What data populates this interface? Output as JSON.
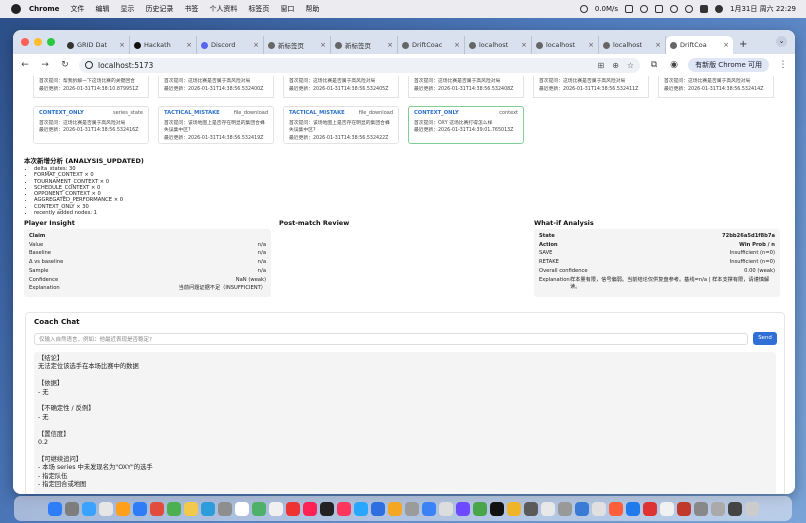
{
  "menubar": {
    "app": "Chrome",
    "items": [
      "文件",
      "编辑",
      "显示",
      "历史记录",
      "书签",
      "个人资料",
      "标签页",
      "窗口",
      "帮助"
    ],
    "network": "0.0M/s",
    "datetime": "1月31日 周六 22:29"
  },
  "tabs": [
    {
      "label": "GRID Dat",
      "active": false,
      "fav": "#333"
    },
    {
      "label": "Hackath",
      "active": false,
      "fav": "#111"
    },
    {
      "label": "Discord",
      "active": false,
      "fav": "#5865f2"
    },
    {
      "label": "新标签页",
      "active": false,
      "fav": "#666"
    },
    {
      "label": "新标签页",
      "active": false,
      "fav": "#666"
    },
    {
      "label": "DriftCoac",
      "active": false,
      "fav": "#666"
    },
    {
      "label": "localhost",
      "active": false,
      "fav": "#666"
    },
    {
      "label": "localhost",
      "active": false,
      "fav": "#666"
    },
    {
      "label": "localhost",
      "active": false,
      "fav": "#666"
    },
    {
      "label": "DriftCoa",
      "active": true,
      "fav": "#666"
    }
  ],
  "toolbar": {
    "url": "localhost:5173",
    "upgrade_label": "有新版 Chrome 可用"
  },
  "top_cards": [
    {
      "l1": "首次提问：帮我拆解一下这场比赛的关键回合",
      "l2": "最近更新：2026-01-31T14:38:10.879951Z"
    },
    {
      "l1": "首次提问：这场比赛是否属于高风险对局",
      "l2": "最近更新：2026-01-31T14:38:56.532400Z"
    },
    {
      "l1": "首次提问：这场比赛是否属于高风险对局",
      "l2": "最近更新：2026-01-31T14:38:56.532405Z"
    },
    {
      "l1": "首次提问：这场比赛是否属于高风险对局",
      "l2": "最近更新：2026-01-31T14:38:56.532408Z"
    },
    {
      "l1": "首次提问：这场比赛是否属于高风险对局",
      "l2": "最近更新：2026-01-31T14:38:56.532411Z"
    },
    {
      "l1": "首次提问：这场比赛是否属于高风险对局",
      "l2": "最近更新：2026-01-31T14:38:56.532414Z"
    }
  ],
  "context_cards": [
    {
      "type": "CONTEXT_ONLY",
      "kind": "series_state",
      "l1": "首次提问：这场比赛是否属于高风险对局",
      "l2": "最近更新：2026-01-31T14:38:56.532416Z",
      "l3": "",
      "highlight": false
    },
    {
      "type": "TACTICAL_MISTAKE",
      "kind": "file_download",
      "l1": "首次提问：该场地图上是否存在明显的集团合蜂",
      "l2": "失误集中区?",
      "l3": "最近更新：2026-01-31T14:38:56.532419Z",
      "highlight": false
    },
    {
      "type": "TACTICAL_MISTAKE",
      "kind": "file_download",
      "l1": "首次提问：该场地图上是否存在明显的集团合蜂",
      "l2": "失误集中区?",
      "l3": "最近更新：2026-01-31T14:38:56.532422Z",
      "highlight": false
    },
    {
      "type": "CONTEXT_ONLY",
      "kind": "context",
      "l1": "首次提问：OXY 这场比赛打得怎么样",
      "l2": "最近更新：2026-01-31T14:39:01.765013Z",
      "l3": "",
      "highlight": true
    }
  ],
  "analysis": {
    "heading": "本次新增分析 (ANALYSIS_UPDATED)",
    "items": [
      "delta_states: 30",
      "FORMAT_CONTEXT × 0",
      "TOURNAMENT_CONTEXT × 0",
      "SCHEDULE_CONTEXT × 0",
      "OPPONENT_CONTEXT × 0",
      "AGGREGATED_PERFORMANCE × 0",
      "CONTEXT_ONLY × 30",
      "recently added nodes: 1"
    ]
  },
  "player_insight": {
    "title": "Player Insight",
    "rows": [
      {
        "k": "Claim",
        "v": "",
        "bold": true
      },
      {
        "k": "Value",
        "v": "n/a",
        "bold": false
      },
      {
        "k": "Baseline",
        "v": "n/a",
        "bold": false
      },
      {
        "k": "Δ vs baseline",
        "v": "n/a",
        "bold": false
      },
      {
        "k": "Sample",
        "v": "n/a",
        "bold": false
      },
      {
        "k": "Confidence",
        "v": "NaN (weak)",
        "bold": false
      },
      {
        "k": "Explanation",
        "v": "当前问题证据不足（INSUFFICIENT）",
        "bold": false
      }
    ]
  },
  "post_match": {
    "title": "Post-match Review"
  },
  "what_if": {
    "title": "What-if Analysis",
    "rows": [
      {
        "k": "State",
        "v": "72bb26a5d1f8b7a",
        "bold": true
      },
      {
        "k": "Action",
        "v": "Win Prob / n",
        "bold": true
      },
      {
        "k": "SAVE",
        "v": "Insufficient (n=0)",
        "bold": false
      },
      {
        "k": "RETAKE",
        "v": "Insufficient (n=0)",
        "bold": false
      },
      {
        "k": "Overall confidence",
        "v": "0.00 (weak)",
        "bold": false
      }
    ],
    "explanation_label": "Explanation",
    "explanation": "样本量有限，信号偏弱。当前结论仅供复盘参考。基线=n/a | 样本支撑有限，请谨慎解读。"
  },
  "coach_chat": {
    "title": "Coach Chat",
    "placeholder": "仅输入自然语言，例如：他最近表现是否稳定?",
    "send_label": "Send",
    "lines": [
      "【结论】",
      "无法定位该选手在本场比赛中的数据",
      "",
      "【依据】",
      "- 无",
      "",
      "【不确定性 / 反例】",
      "- 无",
      "",
      "【置信度】",
      "0.2",
      "",
      "【可继续追问】",
      "- 本场 series 中未发现名为\"OXY\"的选手",
      "- 指定队伍",
      "- 指定回合或地图"
    ]
  },
  "dock_colors": [
    "#2e7cf6",
    "#7d7d7d",
    "#3aa3ff",
    "#e6e6e6",
    "#ff9f1a",
    "#2e7cf6",
    "#e34b3c",
    "#4caf50",
    "#f2c94c",
    "#2d9cdb",
    "#8e8e8e",
    "#ffffff",
    "#4fb06a",
    "#f0f0f0",
    "#e33",
    "#f25",
    "#222",
    "#ff375f",
    "#29a7ff",
    "#2d6ee0",
    "#f5a623",
    "#9b9b9b",
    "#3b82f6",
    "#ddd",
    "#6d4aff",
    "#4aa54a",
    "#111",
    "#f0b429",
    "#5a5a5a",
    "#e8e8e8",
    "#999",
    "#3a7bd5",
    "#e0e0e0",
    "#ff5e3a",
    "#1f7aec",
    "#d33",
    "#f1f1f1",
    "#c0392b",
    "#888",
    "#aaa",
    "#444",
    "#ccc"
  ],
  "colors": {
    "accent": "#2f6fd6",
    "type_label": "#2a70c8",
    "highlight_border": "#7fcf95"
  }
}
